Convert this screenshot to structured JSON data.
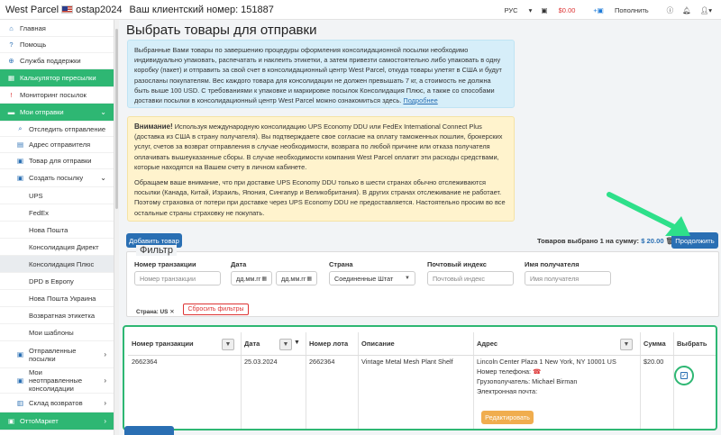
{
  "header": {
    "brand": "West Parcel",
    "username": "ostap2024",
    "client_label": "Ваш клиентский номер: 151887",
    "lang": "РУС",
    "balance": "$0.00",
    "topup": "Пополнить"
  },
  "sidebar": {
    "items": [
      {
        "label": "Главная"
      },
      {
        "label": "Помощь"
      },
      {
        "label": "Служба поддержки"
      },
      {
        "label": "Калькулятор пересылки"
      },
      {
        "label": "Мониторинг посылок"
      },
      {
        "label": "Мои отправки"
      },
      {
        "label": "Отследить отправление"
      },
      {
        "label": "Адрес отправителя"
      },
      {
        "label": "Товар для отправки"
      },
      {
        "label": "Создать посылку"
      },
      {
        "label": "UPS"
      },
      {
        "label": "FedEx"
      },
      {
        "label": "Нова Пошта"
      },
      {
        "label": "Консолидация Директ"
      },
      {
        "label": "Консолидация Плюс"
      },
      {
        "label": "DPD в Европу"
      },
      {
        "label": "Нова Пошта Украина"
      },
      {
        "label": "Возвратная этикетка"
      },
      {
        "label": "Мои шаблоны"
      },
      {
        "label": "Отправленные посылки"
      },
      {
        "label": "Мои неотправленные консолидации"
      },
      {
        "label": "Склад возвратов"
      },
      {
        "label": "OттоМаркет"
      }
    ]
  },
  "main": {
    "title": "Выбрать товары для отправки",
    "info_text": "Выбранные Вами товары по завершению процедуры оформления консолидационной посылки необходимо индивидуально упаковать, распечатать и наклеить этикетки, а затем привезти самостоятельно либо упаковать в одну коробку (пакет) и отправить за свой счет в консолидационный центр West Parcel, откуда товары улетят в США и будут разосланы покупателям. Вес каждого товара для консолидации не должен превышать 7 кг, а стоимость не должна быть выше 100 USD. С требованиями к упаковке и маркировке посылок Консолидация Плюс, а также со способами доставки посылки в консолидационный центр West Parcel можно ознакомиться здесь.",
    "info_link": "Подробнее",
    "warn_title": "Внимание!",
    "warn_p1": "Используя международную консолидацию UPS Economy DDU или FedEx International Connect Plus (доставка из США в страну получателя). Вы подтверждаете свое согласие на оплату таможенных пошлин, брокерских услуг, счетов за возврат отправления в случае необходимости, возврата по любой причине или отказа получателя оплачивать вышеуказанные сборы. В случае необходимости компания West Parcel оплатит эти расходы средствами, которые находятся на Вашем счету в личном кабинете.",
    "warn_p2": "Обращаем ваше внимание, что при доставке UPS Economy DDU только в шести странах обычно отслеживаются посылки (Канада, Китай, Израиль, Япония, Сингапур и Великобритания). В других странах отслеживание не работает. Поэтому страховка от потери при доставке через UPS Economy DDU не предоставляется. Настоятельно просим во все остальные страны страховку не покупать.",
    "add_button": "Добавить товар",
    "total_label": "Товаров выбрано 1 на сумму:",
    "total_sum": "$ 20.00",
    "continue_button": "Продолжить"
  },
  "filter": {
    "legend": "Фильтр",
    "txn_label": "Номер транзакции",
    "txn_placeholder": "Номер транзакции",
    "date_label": "Дата",
    "date_from": "дд.мм.гг",
    "date_to": "дд.мм.гг",
    "country_label": "Страна",
    "country_value": "Соединенные Штат",
    "zip_label": "Почтовый индекс",
    "zip_placeholder": "Почтовый индекс",
    "recipient_label": "Имя получателя",
    "recipient_placeholder": "Имя получателя",
    "chip": "Страна: US",
    "reset_button": "Сбросить фильтры"
  },
  "table": {
    "headers": [
      "Номер транзакции",
      "Дата",
      "Номер лота",
      "Описание",
      "Адрес",
      "Сумма",
      "Выбрать"
    ],
    "row": {
      "txn": "2662364",
      "date": "25.03.2024",
      "lot": "2662364",
      "desc": "Vintage Metal Mesh Plant Shelf",
      "address": "Lincoln Center Plaza 1 New York, NY 10001 US",
      "phone": "Номер телефона:",
      "consignee": "Грузополучатель: Michael Birman",
      "email": "Электронная почта:",
      "edit_button": "Редактировать",
      "sum": "$20.00"
    }
  }
}
